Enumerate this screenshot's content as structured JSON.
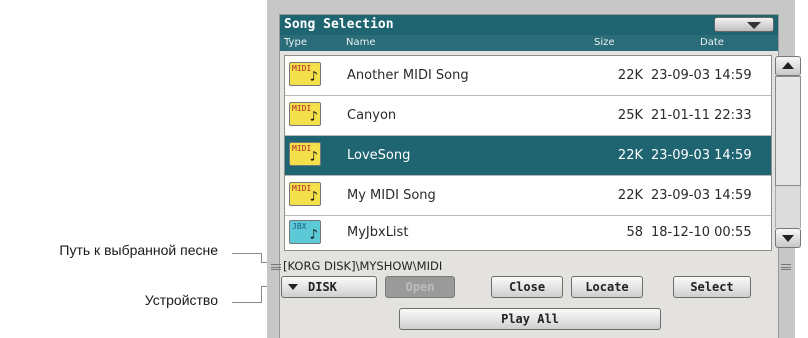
{
  "callouts": {
    "path_label": "Путь к выбранной песне",
    "device_label": "Устройство"
  },
  "window": {
    "title": "Song Selection"
  },
  "columns": {
    "type": "Type",
    "name": "Name",
    "size": "Size",
    "date": "Date"
  },
  "files": [
    {
      "icon": "midi-file-icon",
      "icon_text": "MIDI",
      "name": "Another MIDI Song",
      "size": "22K",
      "date": "23-09-03 14:59",
      "selected": false
    },
    {
      "icon": "midi-file-icon",
      "icon_text": "MIDI",
      "name": "Canyon",
      "size": "25K",
      "date": "21-01-11 22:33",
      "selected": false
    },
    {
      "icon": "midi-file-icon",
      "icon_text": "MIDI",
      "name": "LoveSong",
      "size": "22K",
      "date": "23-09-03 14:59",
      "selected": true
    },
    {
      "icon": "midi-file-icon",
      "icon_text": "MIDI",
      "name": "My MIDI Song",
      "size": "22K",
      "date": "23-09-03 14:59",
      "selected": false
    },
    {
      "icon": "jukebox-file-icon",
      "icon_text": "JBX",
      "name": "MyJbxList",
      "size": "58",
      "date": "18-12-10 00:55",
      "selected": false
    }
  ],
  "path": "[KORG DISK]\\MYSHOW\\MIDI",
  "buttons": {
    "device": "DISK",
    "open": "Open",
    "close": "Close",
    "locate": "Locate",
    "select": "Select",
    "play_all": "Play All"
  },
  "colors": {
    "accent": "#1f6471",
    "midi_icon": "#f4e04a",
    "jbx_icon": "#5cc9d6"
  }
}
